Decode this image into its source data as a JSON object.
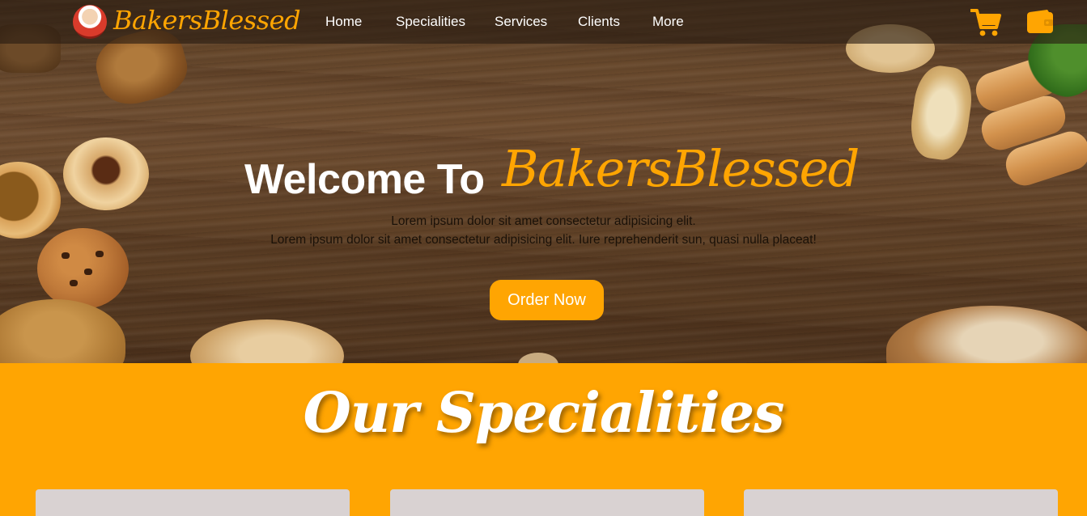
{
  "navbar": {
    "brand": "BakersBlessed",
    "links": [
      "Home",
      "Specialities",
      "Services",
      "Clients",
      "More"
    ],
    "icons": [
      "cart-icon",
      "wallet-icon"
    ],
    "accent_color": "#ffa502"
  },
  "hero": {
    "welcome": "Welcome To",
    "brand": "BakersBlessed",
    "subtitle_1": "Lorem ipsum dolor sit amet consectetur adipisicing elit.",
    "subtitle_2": "Lorem ipsum dolor sit amet consectetur adipisicing elit. Iure reprehenderit sun, quasi nulla placeat!",
    "cta": "Order Now"
  },
  "specialities": {
    "title": "Our Specialities",
    "background": "#ffa502",
    "card_color": "#d9d2d2"
  }
}
